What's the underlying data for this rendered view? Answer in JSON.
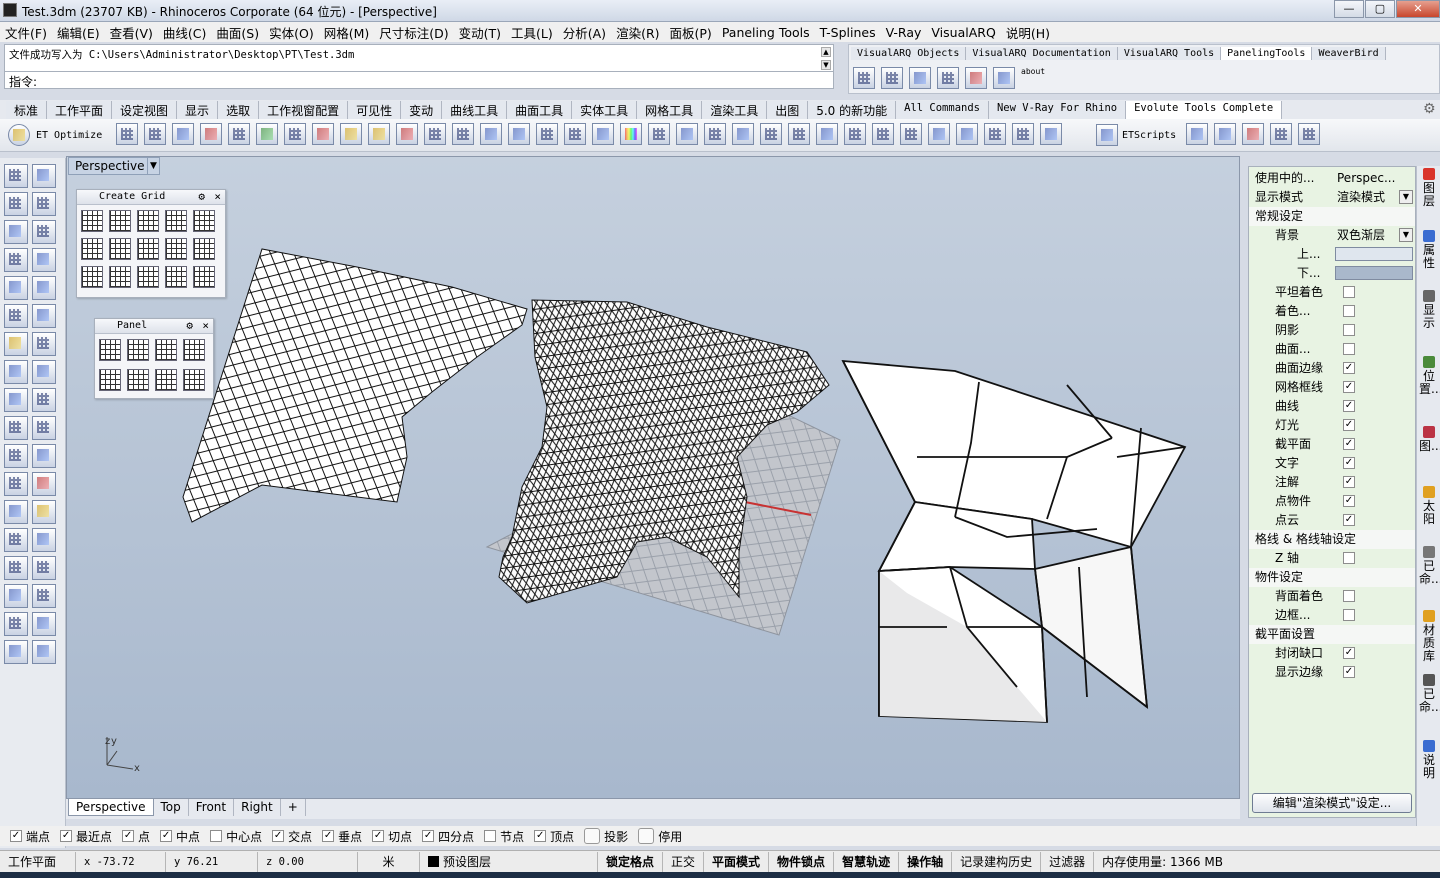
{
  "window": {
    "title": "Test.3dm (23707 KB) - Rhinoceros Corporate (64 位元) - [Perspective]",
    "buttons": [
      "—",
      "▢",
      "✕"
    ]
  },
  "menu": [
    "文件(F)",
    "编辑(E)",
    "查看(V)",
    "曲线(C)",
    "曲面(S)",
    "实体(O)",
    "网格(M)",
    "尺寸标注(D)",
    "变动(T)",
    "工具(L)",
    "分析(A)",
    "渲染(R)",
    "面板(P)",
    "Paneling Tools",
    "T-Splines",
    "V-Ray",
    "VisualARQ",
    "说明(H)"
  ],
  "command": {
    "history": "文件成功写入为 C:\\Users\\Administrator\\Desktop\\PT\\Test.3dm",
    "prompt": "指令:"
  },
  "plugin_tabs": [
    "VisualARQ Objects",
    "VisualARQ Documentation",
    "VisualARQ Tools",
    "PanelingTools",
    "WeaverBird"
  ],
  "plugin_about": "about",
  "main_tabs": [
    "标准",
    "工作平面",
    "设定视图",
    "显示",
    "选取",
    "工作视窗配置",
    "可见性",
    "变动",
    "曲线工具",
    "曲面工具",
    "实体工具",
    "网格工具",
    "渲染工具",
    "出图",
    "5.0 的新功能",
    "All Commands",
    "New V-Ray For Rhino",
    "Evolute Tools Complete"
  ],
  "toolbar": {
    "et_optimize": "ET Optimize",
    "et_scripts": "ETScripts"
  },
  "viewport": {
    "title": "Perspective",
    "axis_z": "z",
    "axis_y": "y",
    "axis_x": "x"
  },
  "floating": {
    "create_grid": "Create Grid",
    "panel": "Panel"
  },
  "viewport_tabs": [
    "Perspective",
    "Top",
    "Front",
    "Right",
    "+"
  ],
  "osnaps": [
    {
      "label": "端点",
      "checked": true
    },
    {
      "label": "最近点",
      "checked": true
    },
    {
      "label": "点",
      "checked": true
    },
    {
      "label": "中点",
      "checked": true
    },
    {
      "label": "中心点",
      "checked": false
    },
    {
      "label": "交点",
      "checked": true
    },
    {
      "label": "垂点",
      "checked": true
    },
    {
      "label": "切点",
      "checked": true
    },
    {
      "label": "四分点",
      "checked": true
    },
    {
      "label": "节点",
      "checked": false
    },
    {
      "label": "顶点",
      "checked": true
    }
  ],
  "osnap_toggles": [
    "投影",
    "停用"
  ],
  "status": {
    "cplane": "工作平面",
    "x": "x -73.72",
    "y": "y 76.21",
    "z": "z 0.00",
    "unit": "米",
    "layer": "预设图层",
    "grid_snap": "锁定格点",
    "ortho": "正交",
    "planar": "平面模式",
    "osnap": "物件锁点",
    "smarttrack": "智慧轨迹",
    "gumball": "操作轴",
    "history": "记录建构历史",
    "filter": "过滤器",
    "memory": "内存使用量: 1366 MB"
  },
  "panel": {
    "viewport_label": "使用中的...",
    "viewport_value": "Perspec...",
    "display_mode_label": "显示模式",
    "display_mode_value": "渲染模式",
    "general": "常规设定",
    "background_label": "背景",
    "background_value": "双色渐层",
    "top_label": "上...",
    "bottom_label": "下...",
    "items": [
      {
        "label": "平坦着色",
        "checked": false
      },
      {
        "label": "着色...",
        "checked": false
      },
      {
        "label": "阴影",
        "checked": false
      },
      {
        "label": "曲面...",
        "checked": false
      },
      {
        "label": "曲面边缘",
        "checked": true
      },
      {
        "label": "网格框线",
        "checked": true
      },
      {
        "label": "曲线",
        "checked": true
      },
      {
        "label": "灯光",
        "checked": true
      },
      {
        "label": "截平面",
        "checked": true
      },
      {
        "label": "文字",
        "checked": true
      },
      {
        "label": "注解",
        "checked": true
      },
      {
        "label": "点物件",
        "checked": true
      },
      {
        "label": "点云",
        "checked": true
      }
    ],
    "grid_section": "格线 & 格线轴设定",
    "z_axis": {
      "label": "Z 轴",
      "checked": false
    },
    "object_section": "物件设定",
    "object_items": [
      {
        "label": "背面着色",
        "checked": false
      },
      {
        "label": "边框...",
        "checked": false
      }
    ],
    "clip_section": "截平面设置",
    "clip_items": [
      {
        "label": "封闭缺口",
        "checked": true
      },
      {
        "label": "显示边缘",
        "checked": true
      }
    ],
    "edit_button": "编辑\"渲染模式\"设定..."
  },
  "side_tabs": [
    "图层",
    "属性",
    "显示",
    "位置...",
    "图...",
    "太阳",
    "已命...",
    "材质库",
    "已命...",
    "说明"
  ],
  "colors": {
    "accent": "#2b4aa8",
    "panel_bg": "#e8f3e3",
    "bg_top": "#c5d0de",
    "bg_bottom": "#a8b8cd"
  }
}
